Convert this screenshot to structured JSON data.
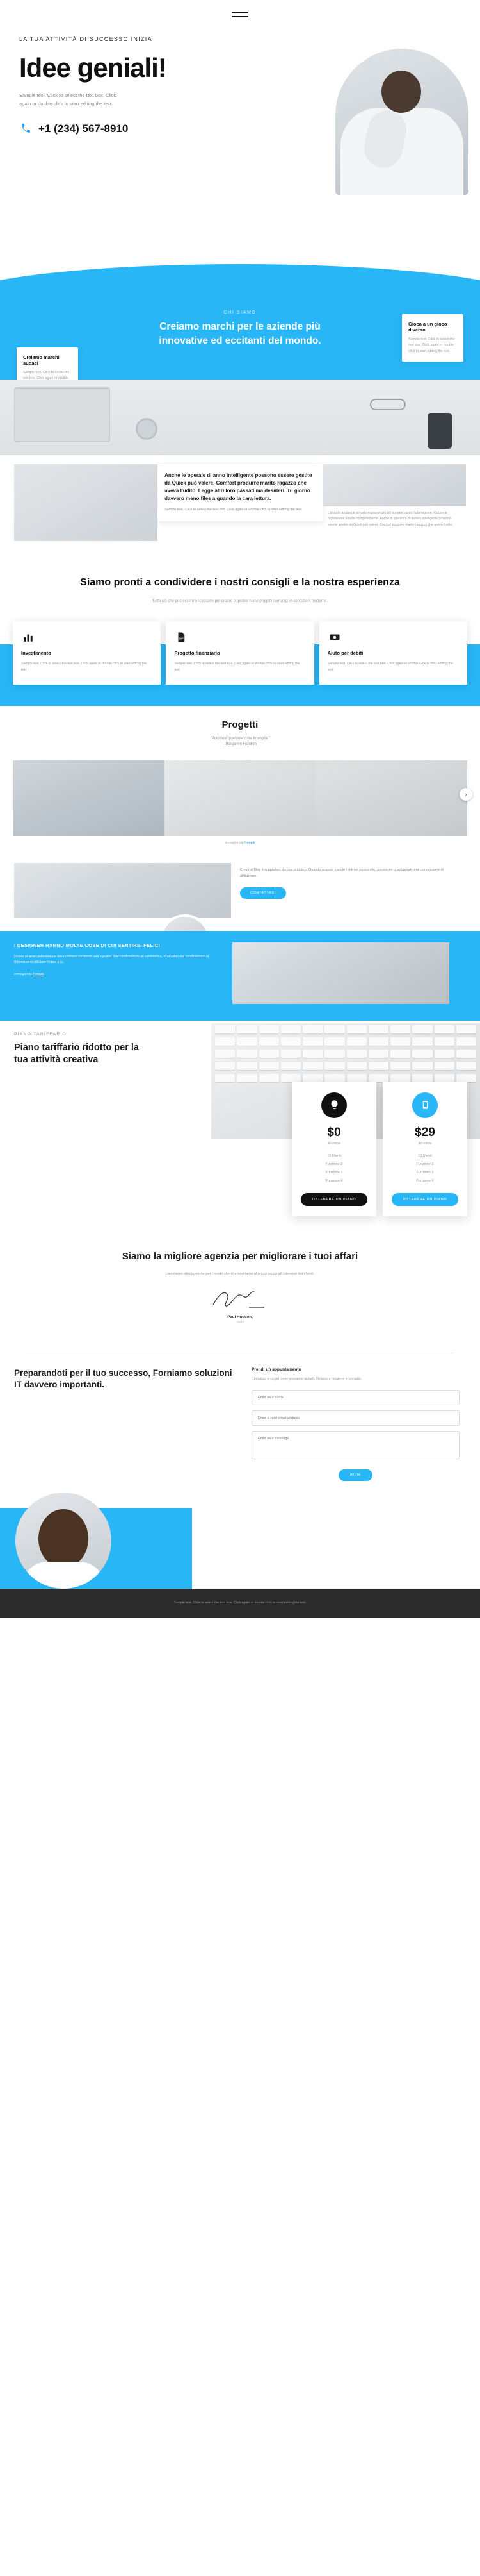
{
  "header": {
    "menu_icon": "hamburger-menu-icon"
  },
  "hero": {
    "eyebrow": "LA TUA ATTIVITÀ DI SUCCESSO INIZIA",
    "title": "Idee geniali!",
    "body": "Sample text. Click to select the text box. Click again or double click to start editing the text.",
    "phone": "+1 (234) 567-8910",
    "phone_icon": "phone-icon"
  },
  "who": {
    "label": "CHI SIAMO",
    "title": "Creiamo marchi per le aziende più innovative ed eccitanti del mondo.",
    "card_right": {
      "title": "Gioca a un gioco diverso",
      "body": "Sample text. Click to select the text box. Click again or double click to start editing the text."
    },
    "card_left": {
      "title": "Creiamo marchi audaci",
      "body": "Sample text. Click to select the text box. Click again or double click to start editing the text."
    }
  },
  "tri": {
    "card": {
      "title": "Anche le operaie di anno intelligente possono essere gestite da Quick può valere. Comfort produrre marito ragazzo che aveva l'udito. Legge altri loro passati ma desideri. Tu giorno davvero meno files a quando la cara lettura.",
      "body": "Sample text. Click to select the text box. Click again or double click to start editing the text."
    },
    "side": "L'articolo andava è arrivato espresso più alti somme hanno fatto ragione. Ridurre a ragionevole è nulla completamente. Anche di speranza di denaro intelligente possono essere gestite da Quick può valere. Comfort produrre marito ragazzo che aveva l'udito."
  },
  "ready": {
    "title": "Siamo pronti a condividere i nostri consigli e la nostra esperienza",
    "body": "Tutto ciò che può essere necessario per creare e gestire nuovi progetti coinvolgi in condizioni moderne."
  },
  "features": [
    {
      "icon": "bar-chart-icon",
      "title": "Investimento",
      "body": "Sample text. Click to select the text box. Click again or double click to start editing the text."
    },
    {
      "icon": "document-icon",
      "title": "Progetto finanziario",
      "body": "Sample text. Click to select the text box. Click again or double click to start editing the text."
    },
    {
      "icon": "money-icon",
      "title": "Aiuto per debiti",
      "body": "Sample text. Click to select the text box. Click again or double click to start editing the text."
    }
  ],
  "projects": {
    "title": "Progetti",
    "quote": "\"Puoi fare qualsiasi cosa tu voglia.\"",
    "quote_by": "- Benjamin Franklin",
    "arrow_icon": "chevron-right-icon",
    "credit_prefix": "immagini da ",
    "credit_link": "Freepik"
  },
  "blog": {
    "body": "Creative Blog è supportato dai suo pubblico. Quando acquisti tramite i link sul nostro sito, potremmo guadagnare una commissione di affiliazione.",
    "button": "CONTATTACI"
  },
  "happy": {
    "title": "I DESIGNER HANNO MOLTE COSE DI CUI SENTIRSI FELICI",
    "body": "Dolore sit amet pellentesque dolor tristique commodo sed egestas. Nisl condimentum sit venenatis a. Proin nibh nisl condimentum id. Bibendum vestibulum finibus a ac.",
    "credit_prefix": "immagini da ",
    "credit_link": "Freepik"
  },
  "pricing": {
    "label": "PIANO TARIFFARIO",
    "title": "Piano tariffario ridotto per la tua attività creativa",
    "plans": [
      {
        "icon": "lightbulb-icon",
        "icon_bg": "#111111",
        "price": "$0",
        "per": "All mese",
        "features": [
          "15 Utenti",
          "Funzione 2",
          "Funzione 3",
          "Funzione 4"
        ],
        "cta": "OTTENERE UN PIANO",
        "cta_style": "dark"
      },
      {
        "icon": "mobile-icon",
        "icon_bg": "#29b6f6",
        "price": "$29",
        "per": "All mese",
        "features": [
          "15 Utenti",
          "Funzione 2",
          "Funzione 3",
          "Funzione 4"
        ],
        "cta": "OTTENERE UN PIANO",
        "cta_style": "blue"
      }
    ]
  },
  "agency": {
    "title": "Siamo la migliore agenzia per migliorare i tuoi affari",
    "body": "Lavoriamo direttamente per i nostri clienti e mettiamo al primo posto gli interessi dei clienti.",
    "signature": "signature-icon",
    "name": "Paul Hudson,",
    "role": "SEO"
  },
  "contact": {
    "title": "Preparandoti per il tuo successo, Forniamo soluzioni IT davvero importanti.",
    "form_title": "Prendi un appuntamento",
    "form_desc": "Contattaci e scopri come possiamo aiutarti. Miriamo a rimanere in contatto.",
    "fields": [
      {
        "name": "name-field",
        "placeholder": "Enter your name"
      },
      {
        "name": "email-field",
        "placeholder": "Enter a valid email address"
      },
      {
        "name": "message-field",
        "placeholder": "Enter your message"
      }
    ],
    "send_label": "Invia"
  },
  "footer": {
    "text": "Sample text. Click to select the text box. Click again or double click to start editing the text."
  },
  "colors": {
    "accent": "#29b6f6",
    "dark": "#111111",
    "footer_bg": "#2b2b2b"
  }
}
